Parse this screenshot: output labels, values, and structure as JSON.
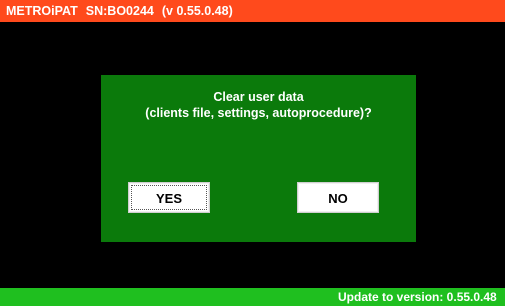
{
  "header": {
    "device": "METROiPAT",
    "serial": "SN:BO0244",
    "version": "(v 0.55.0.48)",
    "background_color": "#ff4a1c"
  },
  "dialog": {
    "message_line1": "Clear user data",
    "message_line2": "(clients file, settings, autoprocedure)?",
    "yes_label": "YES",
    "no_label": "NO",
    "background_color": "#0b7a0b"
  },
  "status_bar": {
    "text": "Update to version: 0.55.0.48",
    "background_color": "#1fbf1f"
  }
}
